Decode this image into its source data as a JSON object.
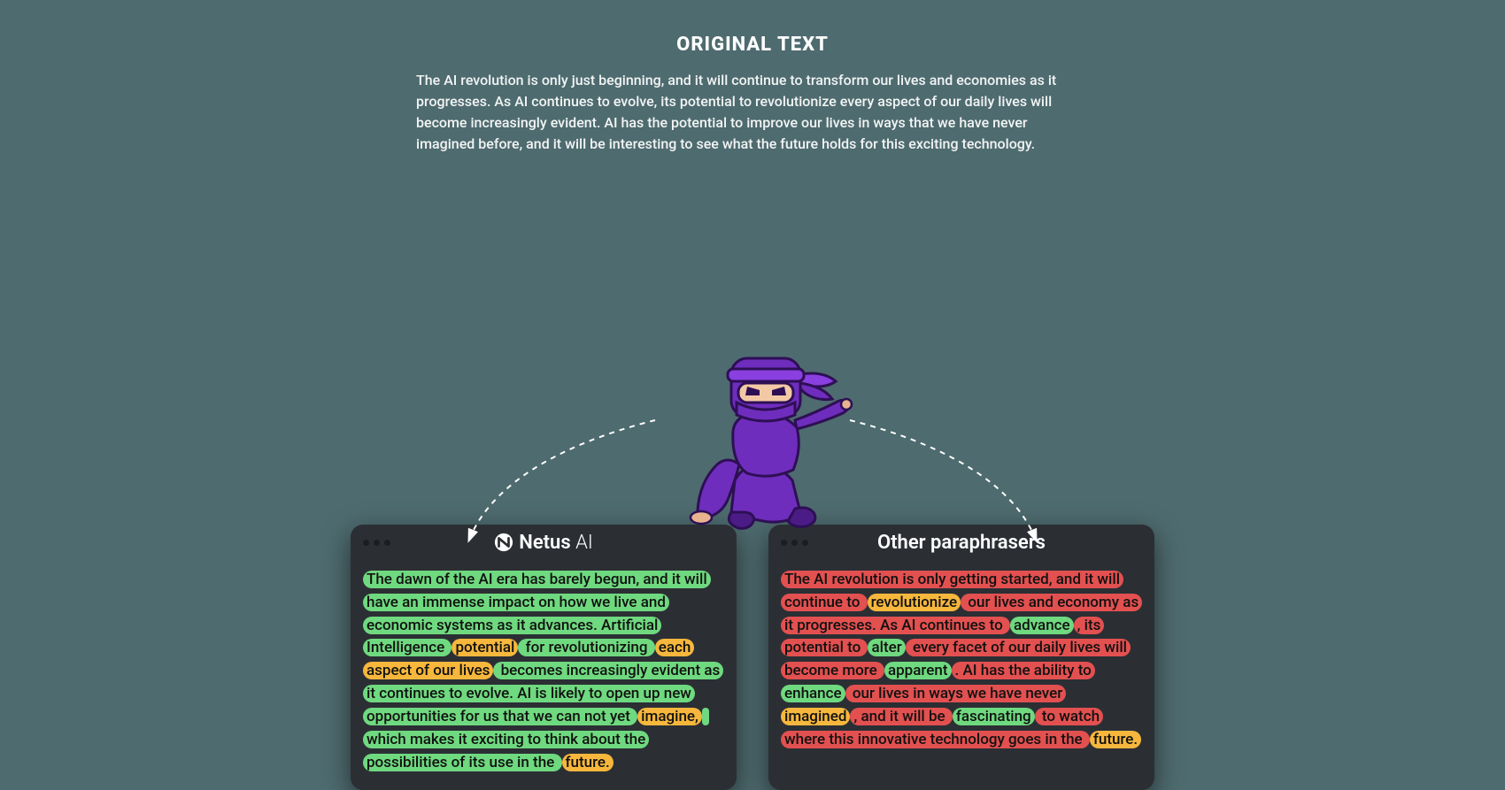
{
  "header": {
    "title": "ORIGINAL TEXT",
    "body": "The AI revolution is only just beginning, and it will continue to transform our lives and economies as it progresses. As AI continues to evolve, its potential to revolutionize every aspect of our daily lives will become increasingly evident. AI has the potential to improve our lives in ways that we have never imagined before, and it will be interesting to see what the future holds for this exciting technology."
  },
  "cards": {
    "netus": {
      "brand_bold": "Netus",
      "brand_light": "AI",
      "segments": [
        {
          "t": "The dawn of the AI era has barely begun, and it will have an immense impact on how we live and economic systems as it advances. Artificial Intelligence ",
          "c": "g"
        },
        {
          "t": "potential",
          "c": "y"
        },
        {
          "t": " for revolutionizing ",
          "c": "g"
        },
        {
          "t": "each aspect of our lives",
          "c": "y"
        },
        {
          "t": " becomes increasingly evident as it continues to evolve. AI is likely to open up new opportunities for us that we can not yet ",
          "c": "g"
        },
        {
          "t": "imagine,",
          "c": "y"
        },
        {
          "t": " which makes it exciting to think about the possibilities of its use in the ",
          "c": "g"
        },
        {
          "t": "future.",
          "c": "y"
        }
      ]
    },
    "other": {
      "title": "Other paraphrasers",
      "segments": [
        {
          "t": "The AI revolution is only getting started, and it will continue to ",
          "c": "r"
        },
        {
          "t": "revolutionize",
          "c": "y"
        },
        {
          "t": " our lives and economy as it progresses. As AI continues to ",
          "c": "r"
        },
        {
          "t": "advance",
          "c": "g"
        },
        {
          "t": ", its potential to ",
          "c": "r"
        },
        {
          "t": "alter",
          "c": "g"
        },
        {
          "t": " every facet of our daily lives will become more ",
          "c": "r"
        },
        {
          "t": "apparent",
          "c": "g"
        },
        {
          "t": ". AI has the ability to ",
          "c": "r"
        },
        {
          "t": "enhance",
          "c": "g"
        },
        {
          "t": " our lives in ways we have never ",
          "c": "r"
        },
        {
          "t": "imagined",
          "c": "y"
        },
        {
          "t": ", and it will be ",
          "c": "r"
        },
        {
          "t": "fascinating",
          "c": "g"
        },
        {
          "t": " to watch where this innovative technology goes in the ",
          "c": "r"
        },
        {
          "t": "future.",
          "c": "y"
        }
      ]
    }
  },
  "colors": {
    "green": "#6fd97f",
    "yellow": "#f6b73c",
    "red": "#e35050",
    "card_bg": "#2b2f34",
    "page_bg": "#4e6b6f",
    "ninja_purple": "#6f2dbd",
    "ninja_purple_dark": "#4b1c85"
  }
}
